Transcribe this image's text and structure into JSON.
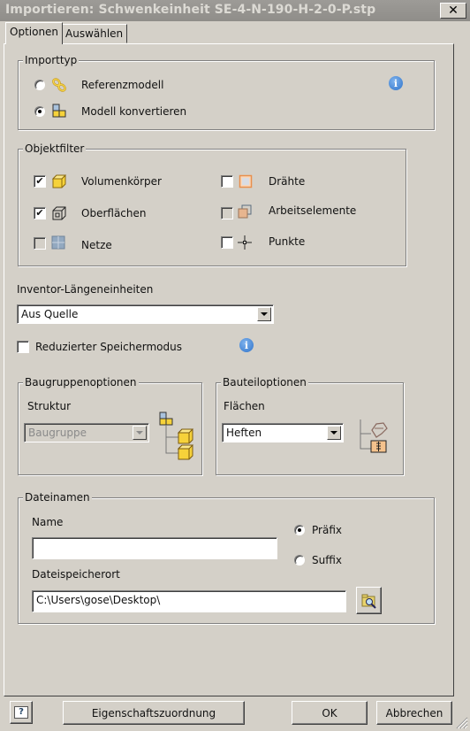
{
  "window": {
    "title": "Importieren: Schwenkeinheit SE-4-N-190-H-2-0-P.stp",
    "close_label": "✕"
  },
  "tabs": [
    {
      "label": "Optionen",
      "active": true
    },
    {
      "label": "Auswählen",
      "active": false
    }
  ],
  "import_type": {
    "legend": "Importtyp",
    "options": [
      {
        "label": "Referenzmodell",
        "selected": false,
        "icon": "reference-link-icon"
      },
      {
        "label": "Modell konvertieren",
        "selected": true,
        "icon": "convert-model-icon"
      }
    ],
    "info_glyph": "i"
  },
  "object_filter": {
    "legend": "Objektfilter",
    "items": [
      {
        "label": "Volumenkörper",
        "checked": true,
        "enabled": true,
        "icon": "solid-body-icon"
      },
      {
        "label": "Oberflächen",
        "checked": true,
        "enabled": true,
        "icon": "surface-icon"
      },
      {
        "label": "Netze",
        "checked": false,
        "enabled": false,
        "icon": "mesh-icon"
      },
      {
        "label": "Drähte",
        "checked": false,
        "enabled": true,
        "icon": "wire-icon"
      },
      {
        "label": "Arbeitselemente",
        "checked": false,
        "enabled": false,
        "icon": "work-features-icon"
      },
      {
        "label": "Punkte",
        "checked": false,
        "enabled": true,
        "icon": "point-icon"
      }
    ],
    "check_glyph": "✔"
  },
  "units": {
    "label": "Inventor-Längeneinheiten",
    "value": "Aus Quelle"
  },
  "reduced_memory": {
    "label": "Reduzierter Speichermodus",
    "checked": false,
    "info_glyph": "i"
  },
  "assembly_options": {
    "legend": "Baugruppenoptionen",
    "structure_label": "Struktur",
    "structure_value": "Baugruppe",
    "enabled": false
  },
  "part_options": {
    "legend": "Bauteiloptionen",
    "surfaces_label": "Flächen",
    "surfaces_value": "Heften"
  },
  "file_names": {
    "legend": "Dateinamen",
    "name_label": "Name",
    "name_value": "",
    "affix_options": [
      {
        "label": "Präfix",
        "selected": true
      },
      {
        "label": "Suffix",
        "selected": false
      }
    ],
    "location_label": "Dateispeicherort",
    "location_value": "C:\\Users\\gose\\Desktop\\"
  },
  "footer": {
    "help_glyph": "?",
    "property_mapping_label": "Eigenschaftszuordnung",
    "ok_label": "OK",
    "cancel_label": "Abbrechen"
  },
  "colors": {
    "dialog_bg": "#d4d0c8",
    "titlebar_bg": "#969490",
    "info_blue": "#2f73c9",
    "icon_yellow": "#f6d23a"
  }
}
